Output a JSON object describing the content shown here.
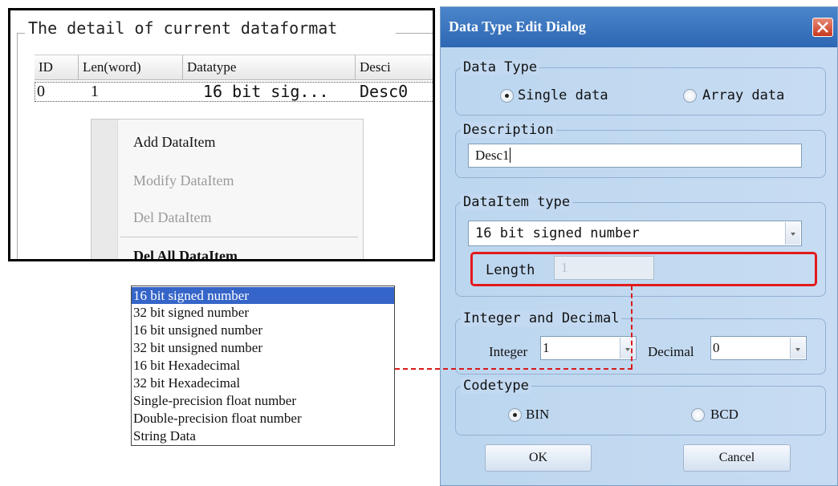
{
  "left_panel": {
    "group_title": "The detail of current dataformat",
    "columns": [
      "ID",
      "Len(word)",
      "Datatype",
      "Desci"
    ],
    "rows": [
      {
        "id": "0",
        "len": "1",
        "datatype": "16 bit sig...",
        "desc": "Desc0"
      }
    ]
  },
  "context_menu": {
    "items": [
      {
        "label": "Add DataItem",
        "enabled": true
      },
      {
        "label": "Modify DataItem",
        "enabled": false
      },
      {
        "label": "Del DataItem",
        "enabled": false
      },
      {
        "label": "Del All DataItem",
        "enabled": true
      }
    ]
  },
  "datatype_list": {
    "selected_index": 0,
    "items": [
      "16 bit signed number",
      "32 bit signed number",
      "16 bit unsigned number",
      "32 bit unsigned number",
      "16 bit Hexadecimal",
      "32 bit Hexadecimal",
      "Single-precision float number",
      "Double-precision float number",
      "String Data"
    ]
  },
  "dialog": {
    "title": "Data Type Edit Dialog",
    "data_type": {
      "group_label": "Data Type",
      "options": [
        "Single data",
        "Array data"
      ],
      "selected": "Single data"
    },
    "description": {
      "group_label": "Description",
      "value": "Desc1"
    },
    "dataitem_type": {
      "group_label": "DataItem type",
      "selected": "16 bit signed number",
      "length_label": "Length",
      "length_value": "1"
    },
    "integer_decimal": {
      "group_label": "Integer and Decimal",
      "integer_label": "Integer",
      "integer_value": "1",
      "decimal_label": "Decimal",
      "decimal_value": "0"
    },
    "codetype": {
      "group_label": "Codetype",
      "options": [
        "BIN",
        "BCD"
      ],
      "selected": "BIN"
    },
    "ok_label": "OK",
    "cancel_label": "Cancel"
  },
  "colors": {
    "highlight_red": "#e21b1b",
    "list_selection": "#3565c8",
    "title_bar": "#2d66b3"
  }
}
